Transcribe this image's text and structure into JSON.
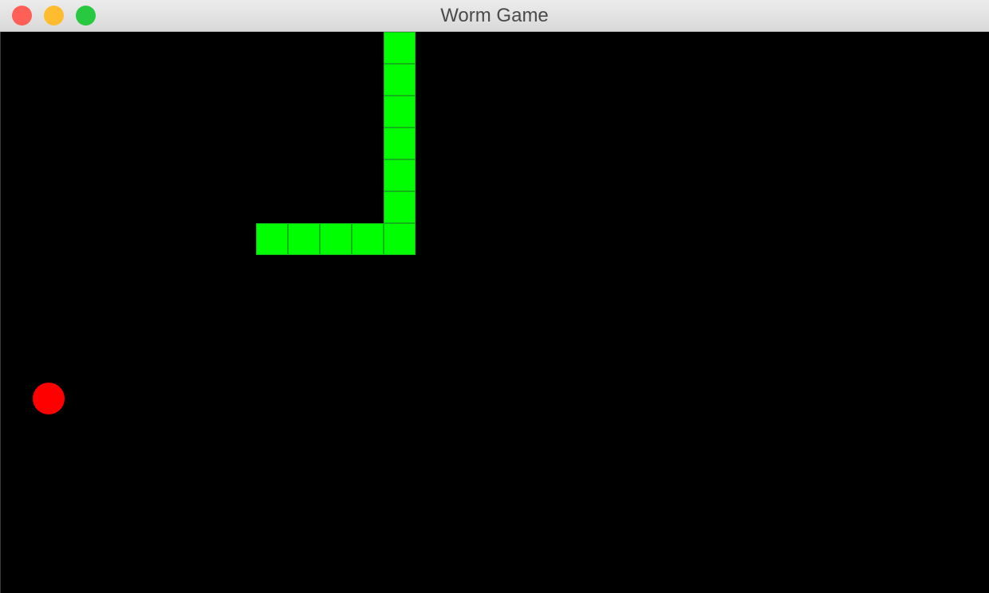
{
  "window": {
    "title": "Worm Game",
    "controls": {
      "close_color": "#fe5f57",
      "minimize_color": "#febc2e",
      "zoom_color": "#28c840"
    }
  },
  "game": {
    "background_color": "#000000",
    "cell_size": 40,
    "worm": {
      "color": "#00ff00",
      "segments": [
        {
          "col": 12,
          "row": 0
        },
        {
          "col": 12,
          "row": 1
        },
        {
          "col": 12,
          "row": 2
        },
        {
          "col": 12,
          "row": 3
        },
        {
          "col": 12,
          "row": 4
        },
        {
          "col": 12,
          "row": 5
        },
        {
          "col": 12,
          "row": 6
        },
        {
          "col": 11,
          "row": 6
        },
        {
          "col": 10,
          "row": 6
        },
        {
          "col": 9,
          "row": 6
        },
        {
          "col": 8,
          "row": 6
        }
      ]
    },
    "apple": {
      "color": "#ff0000",
      "col": 1,
      "row": 11
    }
  }
}
